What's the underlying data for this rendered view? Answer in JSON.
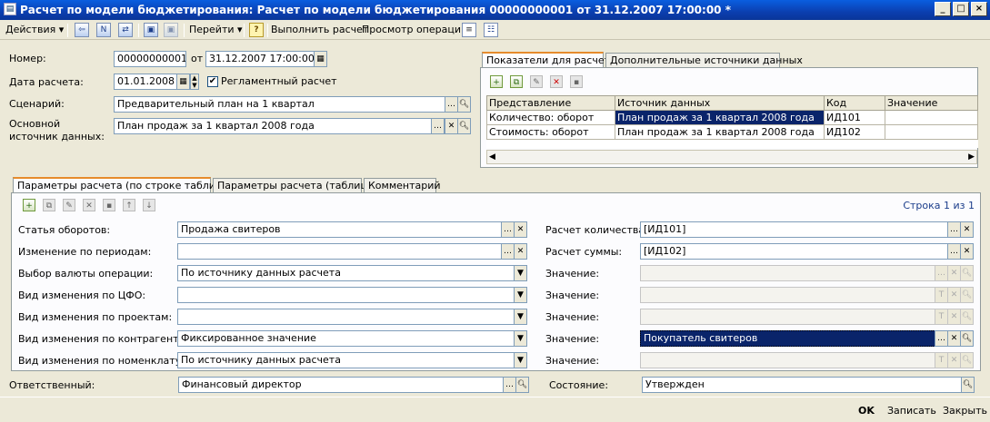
{
  "window": {
    "title": "Расчет по модели бюджетирования: Расчет по модели бюджетирования 00000000001 от 31.12.2007 17:00:00 *"
  },
  "toolbar": {
    "actions": "Действия",
    "goto": "Перейти",
    "help": "?",
    "run": "Выполнить расчет",
    "view_ops": "Просмотр операций"
  },
  "header": {
    "number_label": "Номер:",
    "number": "00000000001",
    "from_label": "от",
    "date": "31.12.2007 17:00:00",
    "calc_date_label": "Дата расчета:",
    "calc_date": "01.01.2008",
    "reglament_label": "Регламентный расчет",
    "scenario_label": "Сценарий:",
    "scenario": "Предварительный план на 1 квартал",
    "source_label": "Основной источник данных:",
    "source": "План продаж за 1 квартал 2008 года"
  },
  "indicators": {
    "tabs": [
      "Показатели для расчета",
      "Дополнительные источники данных"
    ],
    "columns": [
      "Представление",
      "Источник данных",
      "Код",
      "Значение"
    ],
    "rows": [
      [
        "Количество: оборот",
        "План продаж за 1 квартал 2008 года",
        "ИД101",
        ""
      ],
      [
        "Стоимость: оборот",
        "План продаж за 1 квартал 2008 года",
        "ИД102",
        ""
      ]
    ]
  },
  "params": {
    "tabs": [
      "Параметры расчета (по строке таблицы)",
      "Параметры расчета (таблица)",
      "Комментарий"
    ],
    "row_info": "Строка 1 из 1",
    "left": [
      {
        "label": "Статья оборотов:",
        "value": "Продажа свитеров"
      },
      {
        "label": "Изменение по периодам:",
        "value": ""
      },
      {
        "label": "Выбор валюты операции:",
        "value": "По источнику данных расчета"
      },
      {
        "label": "Вид изменения по ЦФО:",
        "value": ""
      },
      {
        "label": "Вид изменения по проектам:",
        "value": ""
      },
      {
        "label": "Вид изменения по контрагентам:",
        "value": "Фиксированное значение"
      },
      {
        "label": "Вид изменения по номенклатуре:",
        "value": "По источнику данных расчета"
      }
    ],
    "right": [
      {
        "label": "Расчет количества:",
        "value": "[ИД101]"
      },
      {
        "label": "Расчет суммы:",
        "value": "[ИД102]"
      },
      {
        "label": "Значение:",
        "value": ""
      },
      {
        "label": "Значение:",
        "value": ""
      },
      {
        "label": "Значение:",
        "value": ""
      },
      {
        "label": "Значение:",
        "value": "Покупатель свитеров"
      },
      {
        "label": "Значение:",
        "value": ""
      }
    ]
  },
  "footer": {
    "responsible_label": "Ответственный:",
    "responsible": "Финансовый директор",
    "state_label": "Состояние:",
    "state": "Утвержден"
  },
  "buttons": {
    "ok": "OK",
    "save": "Записать",
    "close": "Закрыть"
  }
}
